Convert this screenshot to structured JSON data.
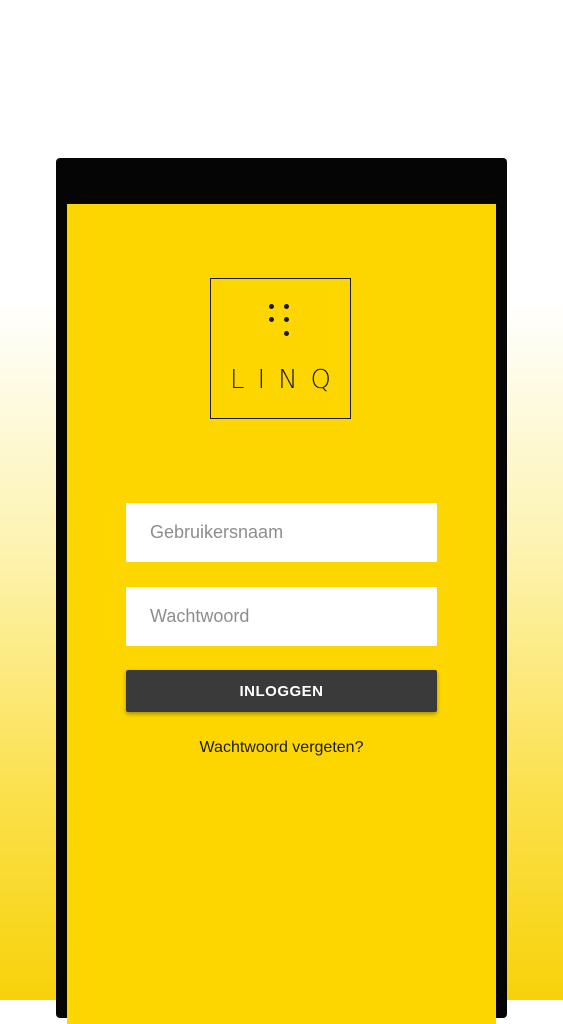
{
  "logo": {
    "text": "LINQ"
  },
  "login_form": {
    "username_placeholder": "Gebruikersnaam",
    "username_value": "",
    "password_placeholder": "Wachtwoord",
    "password_value": "",
    "login_button_label": "INLOGGEN",
    "forgot_password_label": "Wachtwoord vergeten?"
  },
  "colors": {
    "screen_background": "#fdd600",
    "button_background": "#3a3a3a",
    "device_frame": "#050505",
    "input_background": "#ffffff"
  }
}
